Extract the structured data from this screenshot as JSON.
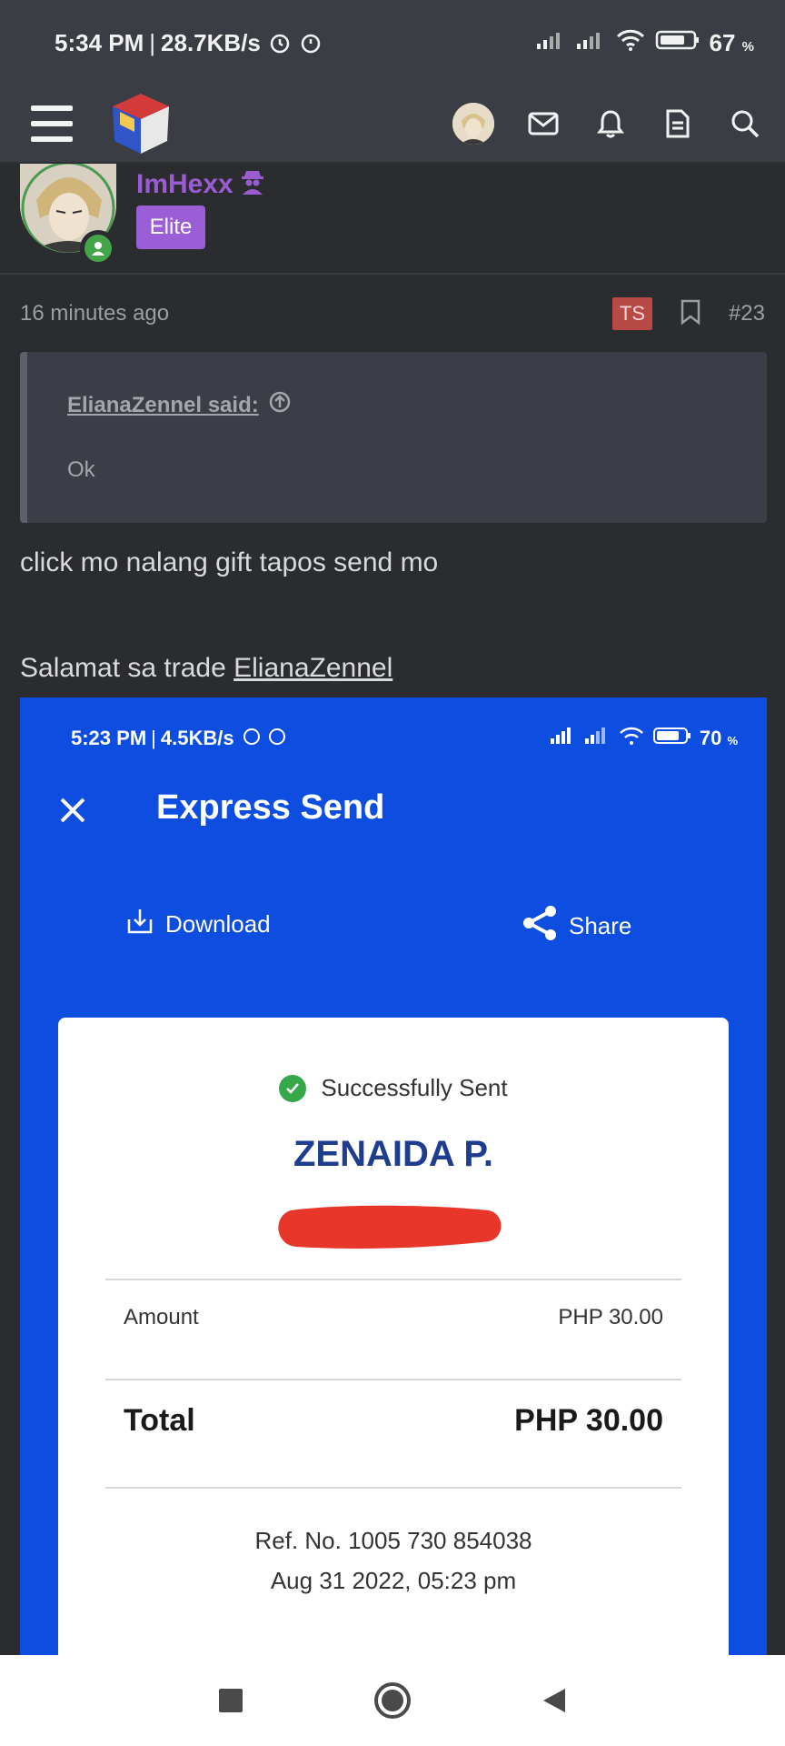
{
  "status_bar": {
    "time": "5:34 PM",
    "separator": "|",
    "speed": "28.7KB/s",
    "battery_percent": "67",
    "battery_unit": "%"
  },
  "post": {
    "username": "ImHexx",
    "role_badge": "Elite",
    "time_ago": "16 minutes ago",
    "ts_badge": "TS",
    "post_number": "#23",
    "quote": {
      "author_said": "ElianaZennel said:",
      "text": "Ok"
    },
    "body_line1": "click mo nalang gift tapos send mo",
    "body_line2_prefix": "Salamat sa trade ",
    "body_line2_link": "ElianaZennel"
  },
  "embedded_screenshot": {
    "status_time": "5:23 PM",
    "status_separator": "|",
    "status_speed": "4.5KB/s",
    "battery_percent": "70",
    "battery_unit": "%",
    "title": "Express Send",
    "download_label": "Download",
    "share_label": "Share",
    "receipt": {
      "status": "Successfully Sent",
      "recipient": "ZENAIDA P.",
      "amount_label": "Amount",
      "amount_value": "PHP 30.00",
      "total_label": "Total",
      "total_value": "PHP 30.00",
      "ref": "Ref. No. 1005 730 854038",
      "datetime": "Aug 31 2022, 05:23 pm"
    }
  },
  "icons": {
    "header": [
      "menu-icon",
      "site-logo",
      "user-avatar",
      "mail-icon",
      "bell-icon",
      "document-icon",
      "search-icon"
    ],
    "nav": [
      "recent-apps-icon",
      "home-icon",
      "back-icon"
    ]
  },
  "colors": {
    "header_bg": "#3a3d44",
    "page_bg": "#2b2c30",
    "username": "#9b5bd1",
    "elite_badge": "#9a5ed6",
    "ts_badge": "#b84a45",
    "embed_blue": "#0d4ee0",
    "recipient_blue": "#1e3d8e",
    "online_green": "#43a547"
  }
}
